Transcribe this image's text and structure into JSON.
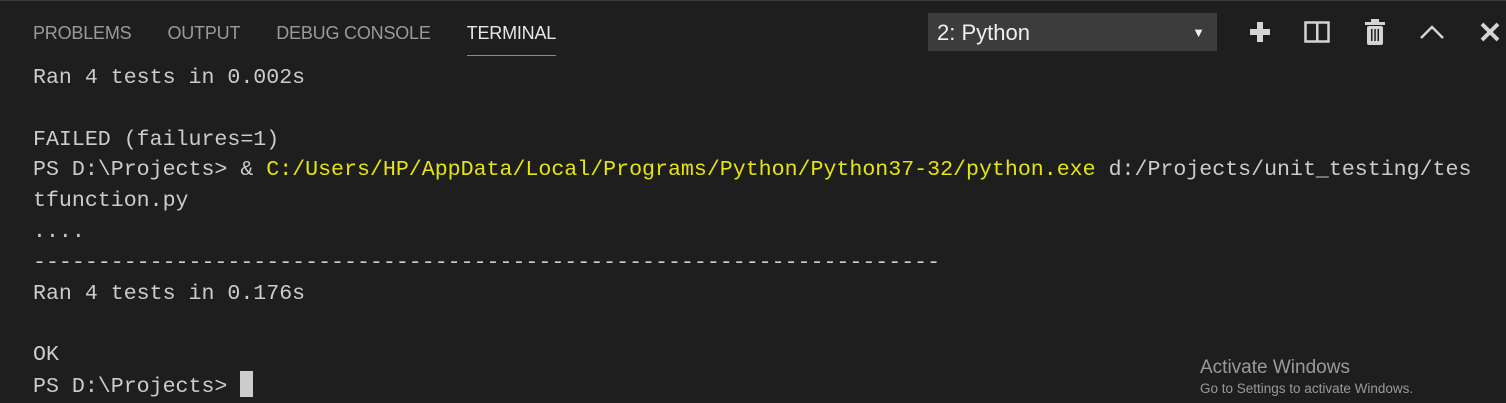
{
  "tabs": [
    {
      "label": "Problems"
    },
    {
      "label": "Output"
    },
    {
      "label": "Debug Console"
    },
    {
      "label": "Terminal",
      "active": true
    }
  ],
  "terminal_select": {
    "value": "2: Python"
  },
  "toolbar": {
    "icons": [
      "plus-icon",
      "split-icon",
      "trash-icon",
      "chevron-up-icon",
      "close-icon"
    ]
  },
  "terminal": {
    "line1": "Ran 4 tests in 0.002s",
    "line2": "FAILED (failures=1)",
    "prompt1": "PS D:\\Projects> & ",
    "cmd_exe": "C:/Users/HP/AppData/Local/Programs/Python/Python37-32/python.exe",
    "cmd_arg1": " d:/Projects/unit_testing/tes",
    "cmd_arg2": "tfunction.py",
    "dots": "....",
    "dashes": "----------------------------------------------------------------------",
    "line3": "Ran 4 tests in 0.176s",
    "ok": "OK",
    "prompt2": "PS D:\\Projects> "
  },
  "watermark": {
    "title": "Activate Windows",
    "subtitle": "Go to Settings to activate Windows."
  },
  "colors": {
    "background": "#1e1e1e",
    "text": "#cccccc",
    "yellow": "#e5e510"
  }
}
